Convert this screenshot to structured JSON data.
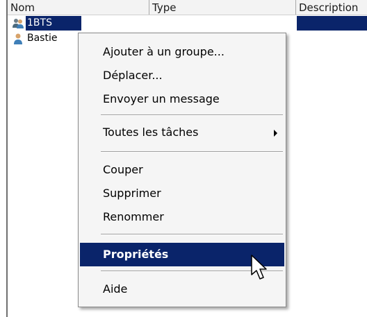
{
  "list": {
    "columns": [
      "Nom",
      "Type",
      "Description"
    ],
    "rows": [
      {
        "name": "1BTS",
        "icon": "group-icon",
        "selected": true
      },
      {
        "name": "Bastie",
        "icon": "user-icon",
        "selected": false
      }
    ]
  },
  "context_menu": {
    "items": [
      {
        "label": "Ajouter à un groupe..."
      },
      {
        "label": "Déplacer..."
      },
      {
        "label": "Envoyer un message"
      },
      {
        "label": "Toutes les tâches",
        "submenu": true
      },
      {
        "label": "Couper"
      },
      {
        "label": "Supprimer"
      },
      {
        "label": "Renommer"
      },
      {
        "label": "Propriétés",
        "bold": true,
        "hovered": true
      },
      {
        "label": "Aide"
      }
    ]
  },
  "colors": {
    "selection": "#0a246a",
    "menu_background": "#f5f5f5"
  },
  "icons": {
    "cursor": "mouse-pointer-icon",
    "submenu": "submenu-arrow-icon"
  }
}
